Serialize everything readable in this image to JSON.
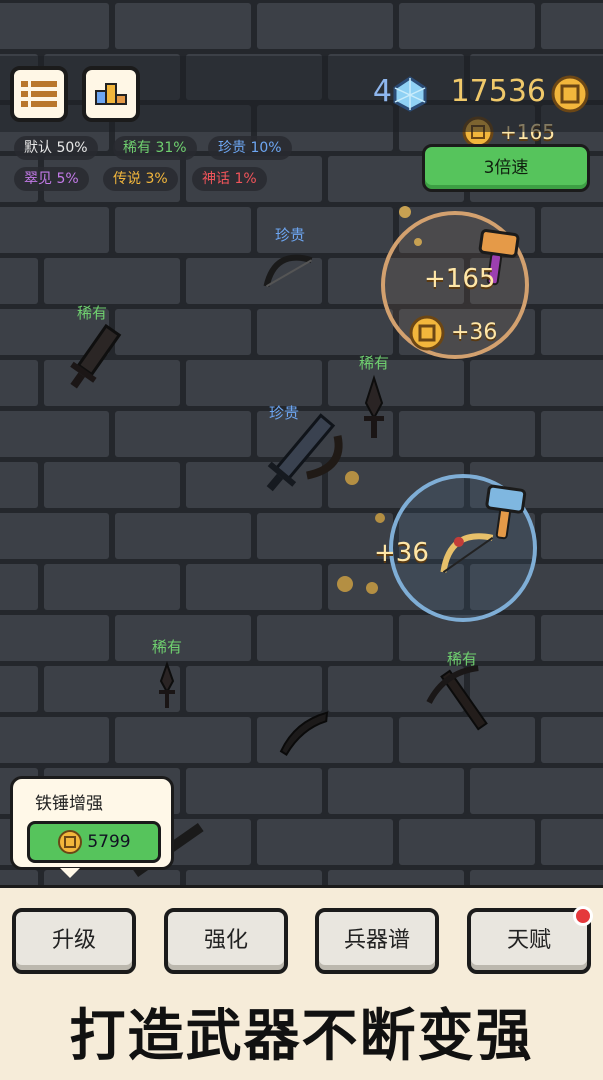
{
  "header": {
    "gem_count": "4",
    "coin_count": "17536"
  },
  "rarities": [
    {
      "label": "默认 50%",
      "color": "#e8e8e8"
    },
    {
      "label": "稀有 31%",
      "color": "#6fd06f"
    },
    {
      "label": "珍贵 10%",
      "color": "#6da6f2"
    },
    {
      "label": "翠见 5%",
      "color": "#c37ae8"
    },
    {
      "label": "传说 3%",
      "color": "#f2b63c"
    },
    {
      "label": "神话 1%",
      "color": "#f0545a"
    }
  ],
  "speed_button": "3倍速",
  "field": {
    "labels": {
      "rare": "稀有",
      "precious": "珍贵"
    },
    "floats": {
      "top_coin": "+165",
      "forge1_main": "+165",
      "forge1_coin": "+36",
      "forge2_main": "+36"
    }
  },
  "popup": {
    "title": "铁锤增强",
    "price": "5799"
  },
  "menu": {
    "upgrade": "升级",
    "enhance": "强化",
    "weapons": "兵器谱",
    "talent": "天赋"
  },
  "slogan": "打造武器不断变强",
  "colors": {
    "rare": "#6fd06f",
    "precious": "#6da6f2",
    "button_green": "#56c45c",
    "coin_gold": "#f0c96a",
    "notification": "#e5393c"
  }
}
